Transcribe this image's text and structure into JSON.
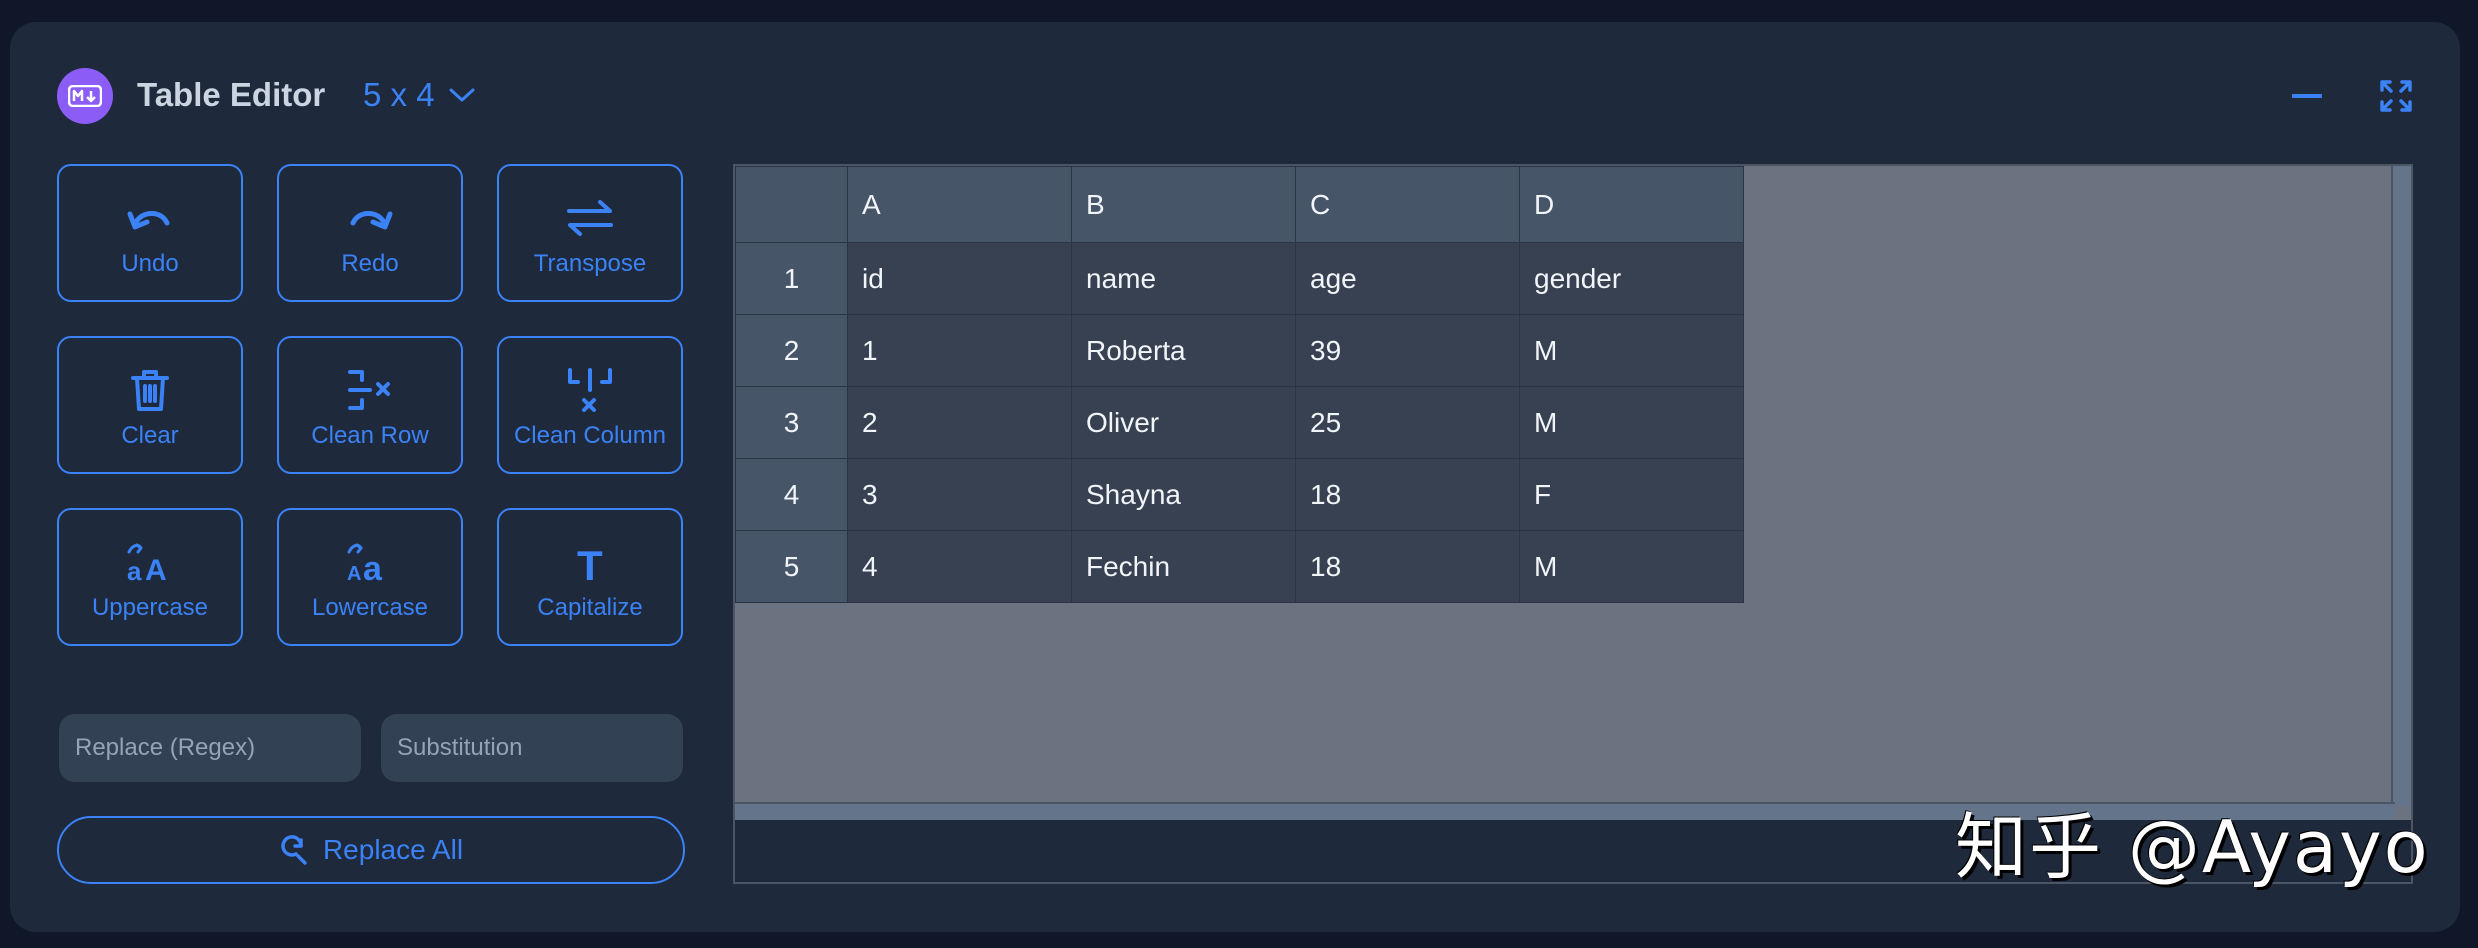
{
  "header": {
    "title": "Table Editor",
    "size_label": "5 x 4",
    "logo_icon": "markdown-icon",
    "accent": "#3b82f6"
  },
  "toolbar": [
    {
      "label": "Undo",
      "icon": "undo-icon"
    },
    {
      "label": "Redo",
      "icon": "redo-icon"
    },
    {
      "label": "Transpose",
      "icon": "transpose-icon"
    },
    {
      "label": "Clear",
      "icon": "trash-icon"
    },
    {
      "label": "Clean Row",
      "icon": "clean-row-icon"
    },
    {
      "label": "Clean Column",
      "icon": "clean-column-icon"
    },
    {
      "label": "Uppercase",
      "icon": "uppercase-icon"
    },
    {
      "label": "Lowercase",
      "icon": "lowercase-icon"
    },
    {
      "label": "Capitalize",
      "icon": "capitalize-icon"
    }
  ],
  "replace": {
    "regex_placeholder": "Replace (Regex)",
    "substitution_placeholder": "Substitution",
    "replace_all_label": "Replace All"
  },
  "grid": {
    "columns": [
      "A",
      "B",
      "C",
      "D"
    ],
    "row_numbers": [
      "1",
      "2",
      "3",
      "4",
      "5"
    ],
    "rows": [
      [
        "id",
        "name",
        "age",
        "gender"
      ],
      [
        "1",
        "Roberta",
        "39",
        "M"
      ],
      [
        "2",
        "Oliver",
        "25",
        "M"
      ],
      [
        "3",
        "Shayna",
        "18",
        "F"
      ],
      [
        "4",
        "Fechin",
        "18",
        "M"
      ]
    ]
  },
  "watermark": "知乎 @Ayayo"
}
